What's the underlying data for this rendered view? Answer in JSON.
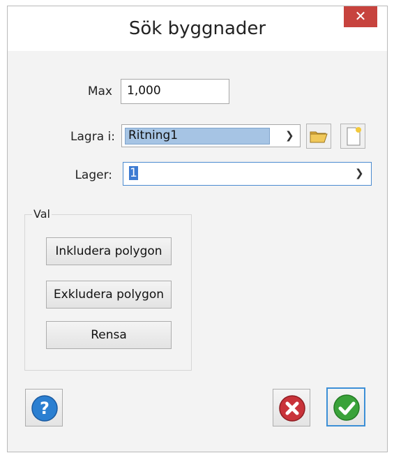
{
  "window": {
    "title": "Sök byggnader",
    "close_glyph": "✕"
  },
  "max": {
    "label": "Max",
    "value": "1,000"
  },
  "lagra": {
    "label": "Lagra i:",
    "value": "Ritning1"
  },
  "lager": {
    "label": "Lager:",
    "value": "1"
  },
  "val_group": {
    "legend": "Val",
    "include_label": "Inkludera polygon",
    "exclude_label": "Exkludera polygon",
    "clear_label": "Rensa"
  },
  "icons": {
    "help": "help-icon",
    "cancel": "cancel-icon",
    "ok": "ok-check-icon",
    "folder": "folder-open-icon",
    "new_doc": "new-document-icon",
    "chevron": "chevron-down-icon"
  },
  "colors": {
    "close_bg": "#c7433e",
    "selection_bg": "#a6c4e4",
    "help_blue": "#2b7fd1",
    "cancel_red": "#c9333a",
    "ok_green": "#3aa23a"
  }
}
